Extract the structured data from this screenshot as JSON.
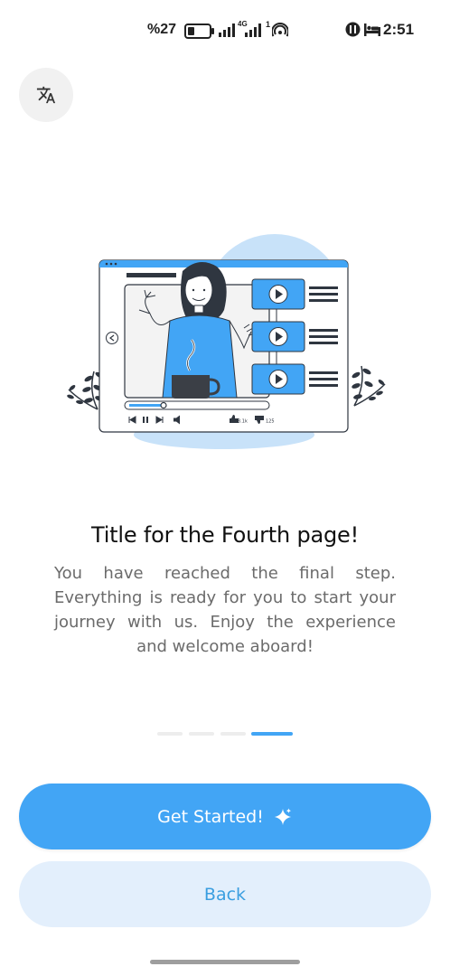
{
  "status_bar": {
    "battery_text": "%27",
    "network_label": "4G",
    "sim_label": "1",
    "time": "2:51"
  },
  "translate": {
    "icon": "translate-icon"
  },
  "page": {
    "title": "Title for the Fourth page!",
    "description": "You have reached the final step. Everything is ready for you to start your journey with us. Enjoy the experience and welcome aboard!"
  },
  "pager": {
    "total": 4,
    "current": 4
  },
  "buttons": {
    "primary_label": "Get Started!",
    "secondary_label": "Back"
  },
  "illustration": {
    "like_count": "3.1k",
    "dislike_count": "125"
  },
  "colors": {
    "accent": "#42a5f5",
    "secondary_bg": "#e3effc",
    "secondary_text": "#3a9ee0",
    "dark": "#2f3640"
  }
}
